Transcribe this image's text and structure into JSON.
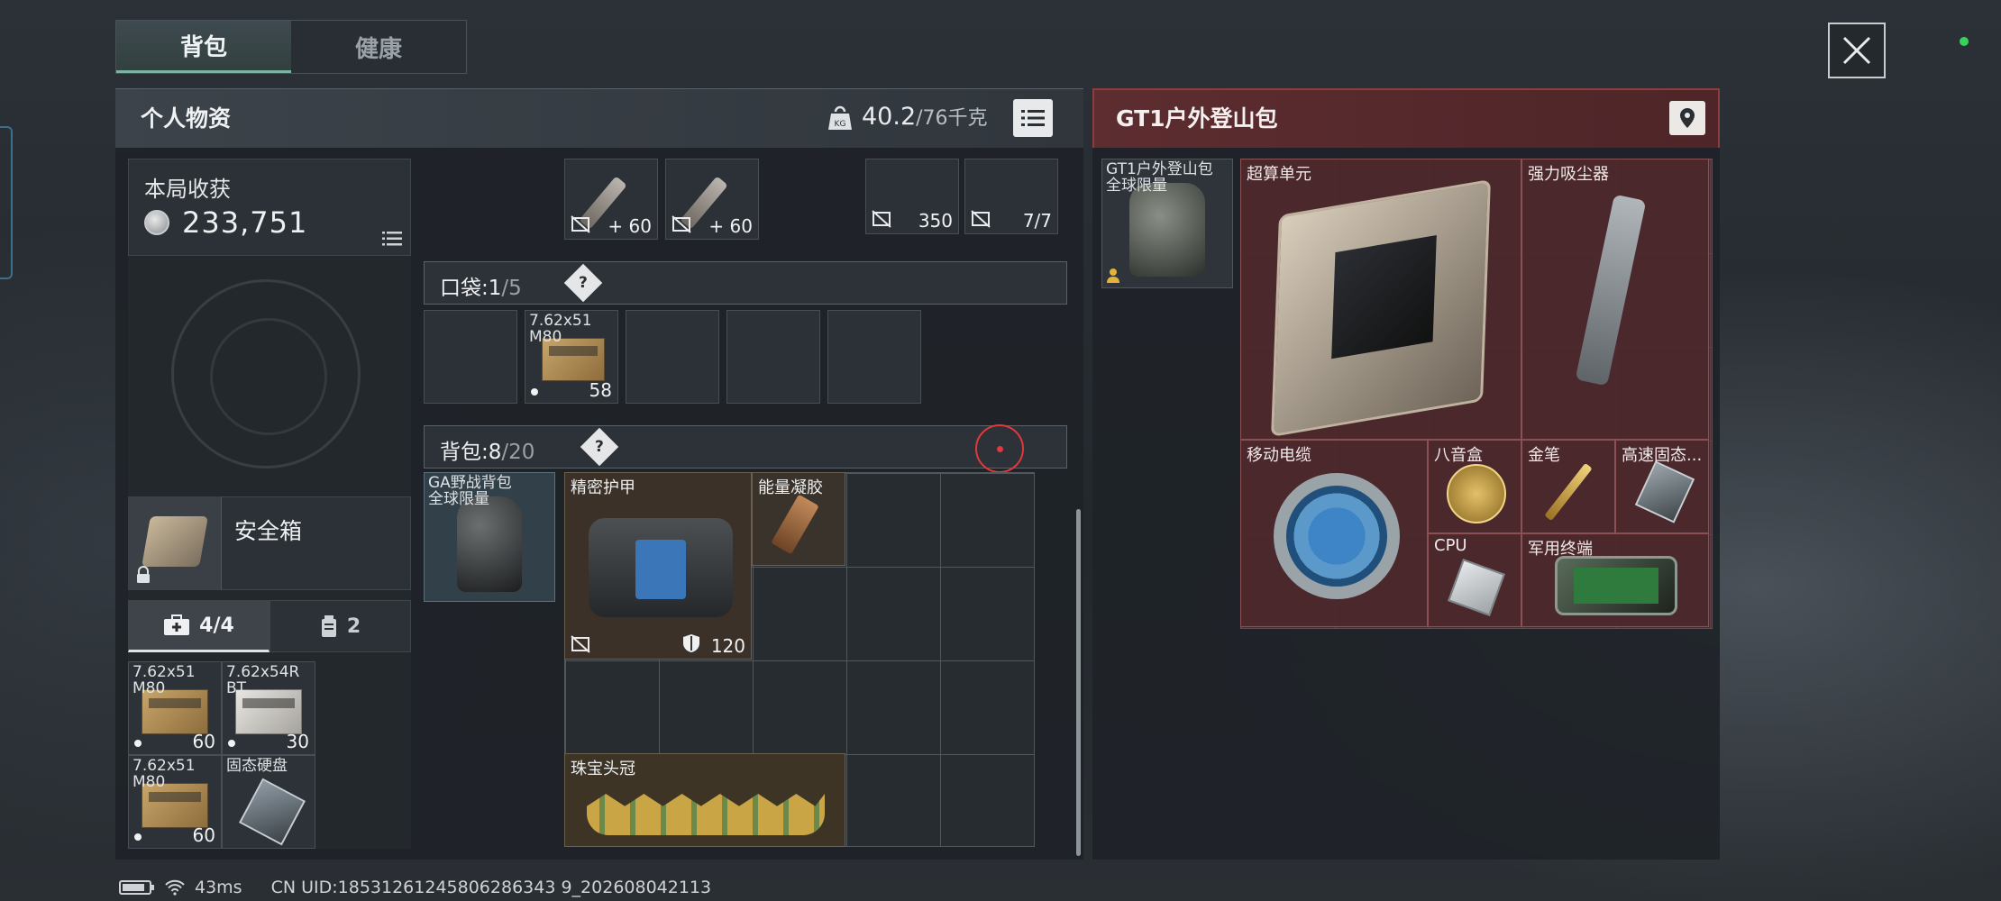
{
  "tabs": [
    {
      "label": "背包",
      "active": true
    },
    {
      "label": "健康",
      "active": false
    }
  ],
  "personal": {
    "title": "个人物资",
    "weight_current": "40.2",
    "weight_rest": "/76千克",
    "loot_label": "本局收获",
    "loot_value": "233,751",
    "safe_box_label": "安全箱",
    "kit_tabs": [
      {
        "label": "4/4",
        "icon": "medkit-icon",
        "active": true
      },
      {
        "label": "2",
        "icon": "canister-icon",
        "active": false
      }
    ]
  },
  "top_slots": [
    {
      "label": "",
      "count": "+ 60",
      "icon": "no-repair-icon"
    },
    {
      "label": "",
      "count": "+ 60",
      "icon": "no-repair-icon"
    },
    {
      "label": "",
      "count": "350",
      "icon": "no-repair-icon"
    },
    {
      "label": "",
      "count": "7/7",
      "icon": "no-repair-icon"
    }
  ],
  "pocket": {
    "label": "口袋:",
    "used": "1",
    "total": "/5",
    "items": [
      {
        "label": "7.62x51\nM80",
        "count": "58"
      }
    ]
  },
  "backpack": {
    "label": "背包:",
    "used": "8",
    "total": "/20",
    "bag_name": "GA野战背包\n全球限量"
  },
  "backpack_items": {
    "armor": {
      "label": "精密护甲",
      "durability": "120"
    },
    "gel": {
      "label": "能量凝胶"
    },
    "crown": {
      "label": "珠宝头冠"
    }
  },
  "kit_items": [
    {
      "label": "7.62x51\nM80",
      "count": "60"
    },
    {
      "label": "7.62x54R\nBT",
      "count": "30"
    },
    {
      "label": "7.62x51\nM80",
      "count": "60"
    },
    {
      "label": "固态硬盘",
      "count": ""
    }
  ],
  "container": {
    "title": "GT1户外登山包",
    "bag_label": "GT1户外登山包\n全球限量",
    "items": [
      {
        "label": "超算单元"
      },
      {
        "label": "强力吸尘器"
      },
      {
        "label": "移动电缆"
      },
      {
        "label": "八音盒"
      },
      {
        "label": "金笔"
      },
      {
        "label": "高速固态..."
      },
      {
        "label": "CPU"
      },
      {
        "label": "军用终端"
      }
    ]
  },
  "status": {
    "ping": "43ms",
    "uid": "CN UID:18531261245806286343 9_202608042113"
  },
  "colors": {
    "accent": "#79b5a0",
    "loot_panel": "#4d2a2d",
    "header_red": "#8d3d40"
  }
}
